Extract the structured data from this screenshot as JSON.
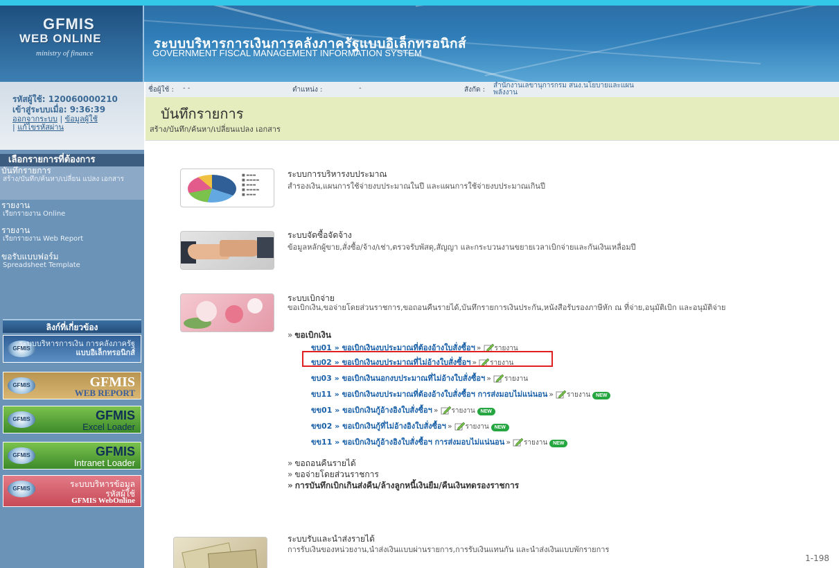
{
  "header": {
    "logo_line1": "GFMIS",
    "logo_line2": "WEB ONLINE",
    "logo_line3": "ministry of finance",
    "title_th": "ระบบบริหารการเงินการคลังภาครัฐแบบอิเล็กทรอนิกส์",
    "title_en": "GOVERNMENT FISCAL MANAGEMENT INFORMATION SYSTEM"
  },
  "user_info": {
    "user_id_label": "รหัสผู้ใช้:",
    "user_id": "120060000210",
    "login_label": "เข้าสู่ระบบเมื่อ:",
    "login_time": "9:36:39",
    "logout_link": "ออกจากระบบ",
    "profile_link": "ข้อมูลผู้ใช้",
    "change_password_link": "แก้ไขรหัสผ่าน"
  },
  "sidebar": {
    "menu_header": "เลือกรายการที่ต้องการ",
    "items": [
      {
        "title": "บันทึกรายการ",
        "sub": "สร้าง/บันทึก/ค้นหา/เปลี่ยน แปลง เอกสาร"
      },
      {
        "title": "รายงาน",
        "sub": "เรียกรายงาน Online"
      },
      {
        "title": "รายงาน",
        "sub": "เรียกรายงาน Web Report"
      },
      {
        "title": "ขอรับแบบฟอร์ม",
        "sub": "Spreadsheet Template"
      }
    ],
    "related_header": "ลิงก์ที่เกี่ยวข้อง",
    "banners": [
      {
        "badge": "GFMIS",
        "line1": "ระบบบริหารการเงิน การคลังภาครัฐ",
        "line2": "แบบอิเล็กทรอนิกส์"
      },
      {
        "badge": "GFMIS",
        "line1": "GFMIS",
        "line2": "WEB REPORT"
      },
      {
        "badge": "GFMIS",
        "line1": "GFMIS",
        "line2": "Excel Loader"
      },
      {
        "badge": "GFMIS",
        "line1": "GFMIS",
        "line2": "Intranet Loader"
      },
      {
        "badge": "GFMIS",
        "line1": "ระบบบริหารข้อมูล",
        "line2": "รหัสผู้ใช้",
        "line3": "GFMIS WebOnline"
      }
    ]
  },
  "info_bar": {
    "user_label": "ชื่อผู้ใช้ :",
    "user_value": "- -",
    "position_label": "ตำแหน่ง :",
    "position_value": "-",
    "affiliation_label": "สังกัด :",
    "affiliation_value": "สำนักงานเลขานุการกรม สนง.นโยบายและแผนพลังงาน"
  },
  "page": {
    "title": "บันทึกรายการ",
    "subtitle": "สร้าง/บันทึก/ค้นหา/เปลี่ยนแปลง เอกสาร"
  },
  "systems": [
    {
      "title": "ระบบการบริหารงบประมาณ",
      "desc": "สำรองเงิน,แผนการใช้จ่ายงบประมาณในปี และแผนการใช้จ่ายงบประมาณเกินปี"
    },
    {
      "title": "ระบบจัดซื้อจัดจ้าง",
      "desc": "ข้อมูลหลักผู้ขาย,สั่งซื้อ/จ้าง/เช่า,ตรวจรับพัสดุ,สัญญา และกระบวนงานขยายเวลาเบิกจ่ายและกันเงินเหลื่อมปี"
    },
    {
      "title": "ระบบเบิกจ่าย",
      "desc": "ขอเบิกเงิน,ขอจ่ายโดยส่วนราชการ,ขอถอนคืนรายได้,บันทึกรายการเงินประกัน,หนังสือรับรองภาษีหัก ณ ที่จ่าย,อนุมัติเบิก และอนุมัติจ่าย"
    },
    {
      "title": "ระบบรับและนำส่งรายได้",
      "desc": "การรับเงินของหน่วยงาน,นำส่งเงินแบบผ่านรายการ,การรับเงินแทนกัน และนำส่งเงินแบบพักรายการ"
    }
  ],
  "disbursement": {
    "sub_withdraw": "ขอเบิกเงิน",
    "links": [
      {
        "text": "ขบ01 » ขอเบิกเงินงบประมาณที่ต้องอ้างใบสั่งซื้อฯ",
        "report": "รายงาน",
        "new": ""
      },
      {
        "text": "ขบ02 » ขอเบิกเงินงบประมาณที่ไม่อ้างใบสั่งซื้อฯ",
        "report": "รายงาน",
        "new": ""
      },
      {
        "text": "ขบ03 » ขอเบิกเงินนอกงบประมาณที่ไม่อ้างใบสั่งซื้อฯ",
        "report": "รายงาน",
        "new": ""
      },
      {
        "text": "ขบ11 » ขอเบิกเงินงบประมาณที่ต้องอ้างใบสั่งซื้อฯ การส่งมอบไม่แน่นอน",
        "report": "รายงาน",
        "new": "NEW"
      },
      {
        "text": "ขข01 » ขอเบิกเงินกู้อ้างอิงใบสั่งซื้อฯ",
        "report": "รายงาน",
        "new": "NEW"
      },
      {
        "text": "ขข02 » ขอเบิกเงินกู้ที่ไม่อ้างอิงใบสั่งซื้อฯ",
        "report": "รายงาน",
        "new": "NEW"
      },
      {
        "text": "ขข11 » ขอเบิกเงินกู้อ้างอิงใบสั่งซื้อฯ การส่งมอบไม่แน่นอน",
        "report": "รายงาน",
        "new": "NEW"
      }
    ],
    "sub_refund": "ขอถอนคืนรายได้",
    "sub_agency_pay": "ขอจ่ายโดยส่วนราชการ",
    "sub_record": "การบันทึกเบิกเกินส่งคืน/ล้างลูกหนี้เงินยืม/คืนเงินทดรองราชการ"
  },
  "footer": {
    "page_number": "1-198"
  },
  "colors": {
    "highlight": "#e02020",
    "link": "#1a60a8",
    "page_head_bg": "#e5ecbd",
    "sidebar_bg": "#6b93b8"
  }
}
